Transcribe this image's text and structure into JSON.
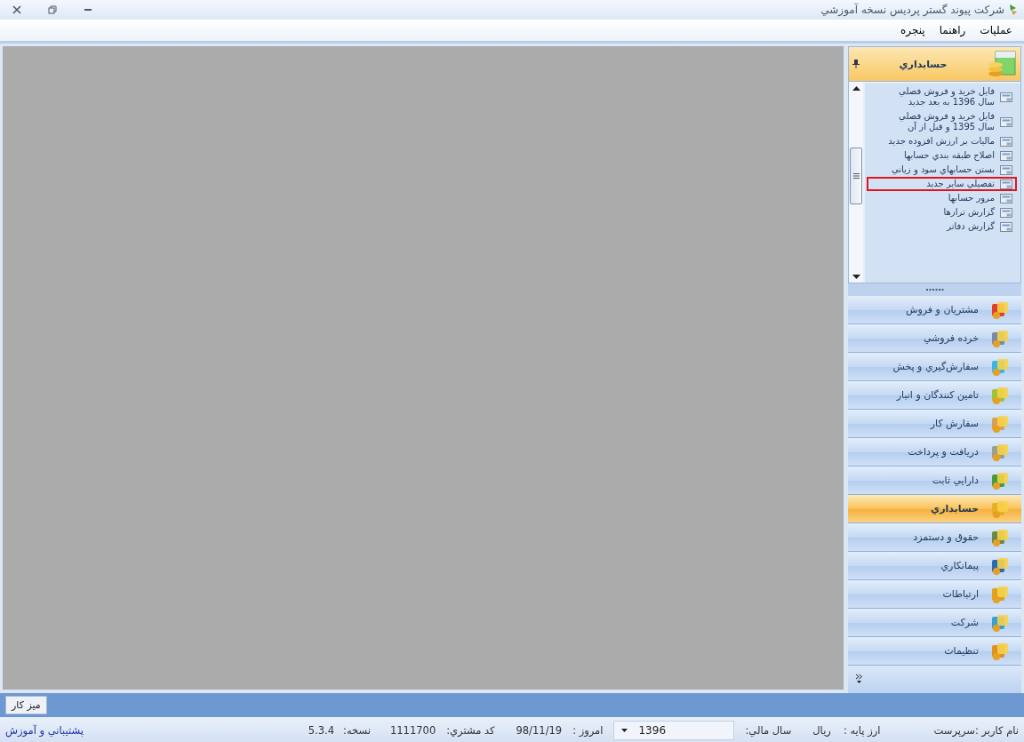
{
  "window": {
    "title": "شركت پيوند گستر پرديس نسخه آموزشي"
  },
  "menu": [
    {
      "label": "عمليات"
    },
    {
      "label": "راهنما"
    },
    {
      "label": "پنجره"
    }
  ],
  "panel": {
    "title": "حسابداري",
    "items": [
      {
        "label": "فايل خريد و فروش فصلي سال 1396 به بعد جديد",
        "highlighted": false
      },
      {
        "label": "فايل خريد و فروش فصلي سال 1395 و قبل از آن",
        "highlighted": false
      },
      {
        "label": "ماليات بر ارزش افزوده جديد",
        "highlighted": false
      },
      {
        "label": "اصلاح طبقه بندي حسابها",
        "highlighted": false
      },
      {
        "label": "بستن حسابهاي سود و زياني",
        "highlighted": false
      },
      {
        "label": "تفصيلي ساير جديد",
        "highlighted": true
      },
      {
        "label": "مرور حسابها",
        "highlighted": false
      },
      {
        "label": "گزارش ترازها",
        "highlighted": false
      },
      {
        "label": "گزارش دفاتر",
        "highlighted": false
      }
    ]
  },
  "modules": [
    {
      "label": "مشتريان و فروش",
      "selected": false
    },
    {
      "label": "خرده فروشي",
      "selected": false
    },
    {
      "label": "سفارش‌گيري و پخش",
      "selected": false
    },
    {
      "label": "تامين كنندگان و انبار",
      "selected": false
    },
    {
      "label": "سفارش كار",
      "selected": false
    },
    {
      "label": "دريافت و پرداخت",
      "selected": false
    },
    {
      "label": "دارايي ثابت",
      "selected": false
    },
    {
      "label": "حسابداري",
      "selected": true
    },
    {
      "label": "حقوق و دستمزد",
      "selected": false
    },
    {
      "label": "پيمانكاري",
      "selected": false
    },
    {
      "label": "ارتباطات",
      "selected": false
    },
    {
      "label": "شركت",
      "selected": false
    },
    {
      "label": "تنظيمات",
      "selected": false
    }
  ],
  "taskbar": {
    "button": "ميز كار"
  },
  "status_bar": {
    "user": "نام كاربر :سرپرست",
    "currency_label": "ارز پايه :",
    "currency": "ريال",
    "fiscal_year_label": "سال مالي:",
    "fiscal_year": "1396",
    "today_label": "امروز :",
    "today": "98/11/19",
    "customer_code_label": "كد مشتري:",
    "customer_code": "1111700",
    "version_label": "نسخه:",
    "version": "5.3.4",
    "support_link": "پشتيباني و آموزش"
  }
}
